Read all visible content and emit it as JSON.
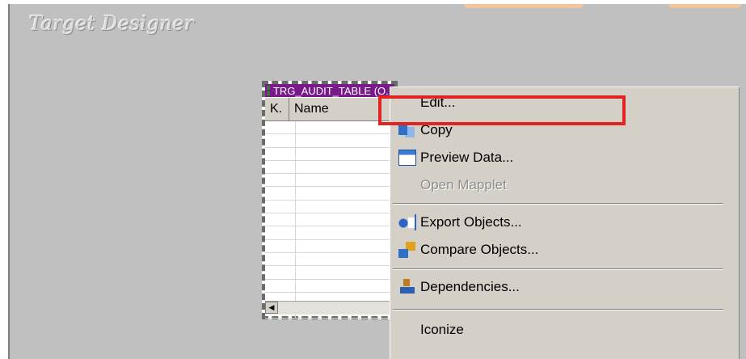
{
  "workspace": {
    "title": "Target Designer"
  },
  "table_object": {
    "title": "TRG_AUDIT_TABLE (O...",
    "columns": [
      "K.",
      "Name"
    ],
    "row_count": 16
  },
  "context_menu": {
    "items": [
      {
        "label": "Edit...",
        "enabled": true,
        "icon": "none"
      },
      {
        "label": "Copy",
        "enabled": true,
        "icon": "copy-icon"
      },
      {
        "label": "Preview Data...",
        "enabled": true,
        "icon": "preview-data-icon"
      },
      {
        "label": "Open Mapplet",
        "enabled": false,
        "icon": "none"
      },
      {
        "label": "Export Objects...",
        "enabled": true,
        "icon": "export-icon"
      },
      {
        "label": "Compare Objects...",
        "enabled": true,
        "icon": "compare-icon"
      },
      {
        "label": "Dependencies...",
        "enabled": true,
        "icon": "dependencies-icon"
      },
      {
        "label": "Iconize",
        "enabled": true,
        "icon": "none"
      }
    ]
  },
  "colors": {
    "workspace_bg": "#c0c0c0",
    "table_title_bg": "#7a1a8a",
    "menu_bg": "#d4d0c8",
    "highlight": "#e02424"
  }
}
